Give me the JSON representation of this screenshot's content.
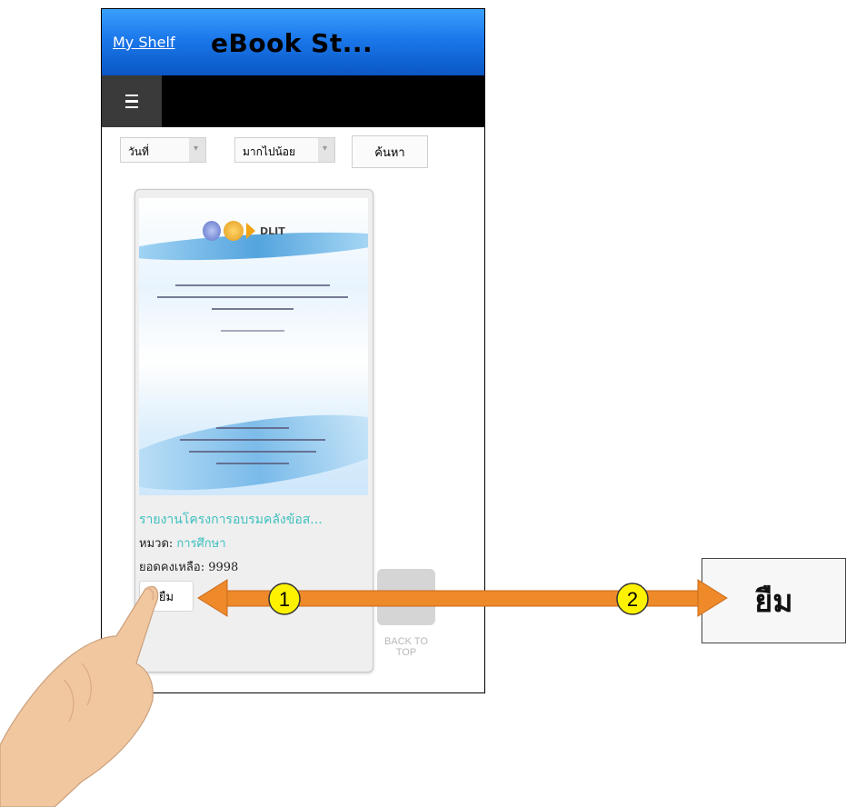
{
  "header": {
    "my_shelf": "My Shelf",
    "title": "eBook St..."
  },
  "menu": {
    "icon": "hamburger-icon"
  },
  "filters": {
    "sort_field": "วันที่",
    "sort_order": "มากไปน้อย",
    "search_button": "ค้นหา"
  },
  "book": {
    "cover_logo_text": "DLIT",
    "title": "รายงานโครงการอบรมคลังข้อส...",
    "category_label": "หมวด:",
    "category_value": "การศึกษา",
    "remaining_label": "ยอดคงเหลือ: 9998",
    "borrow_button": "ยืม"
  },
  "back_to_top": {
    "line1": "BACK TO",
    "line2": "TOP"
  },
  "annotation": {
    "step1": "1",
    "step2": "2",
    "zoom_label": "ยืม",
    "arrow_color": "#ee8a2a",
    "marker_color": "#fff200"
  }
}
